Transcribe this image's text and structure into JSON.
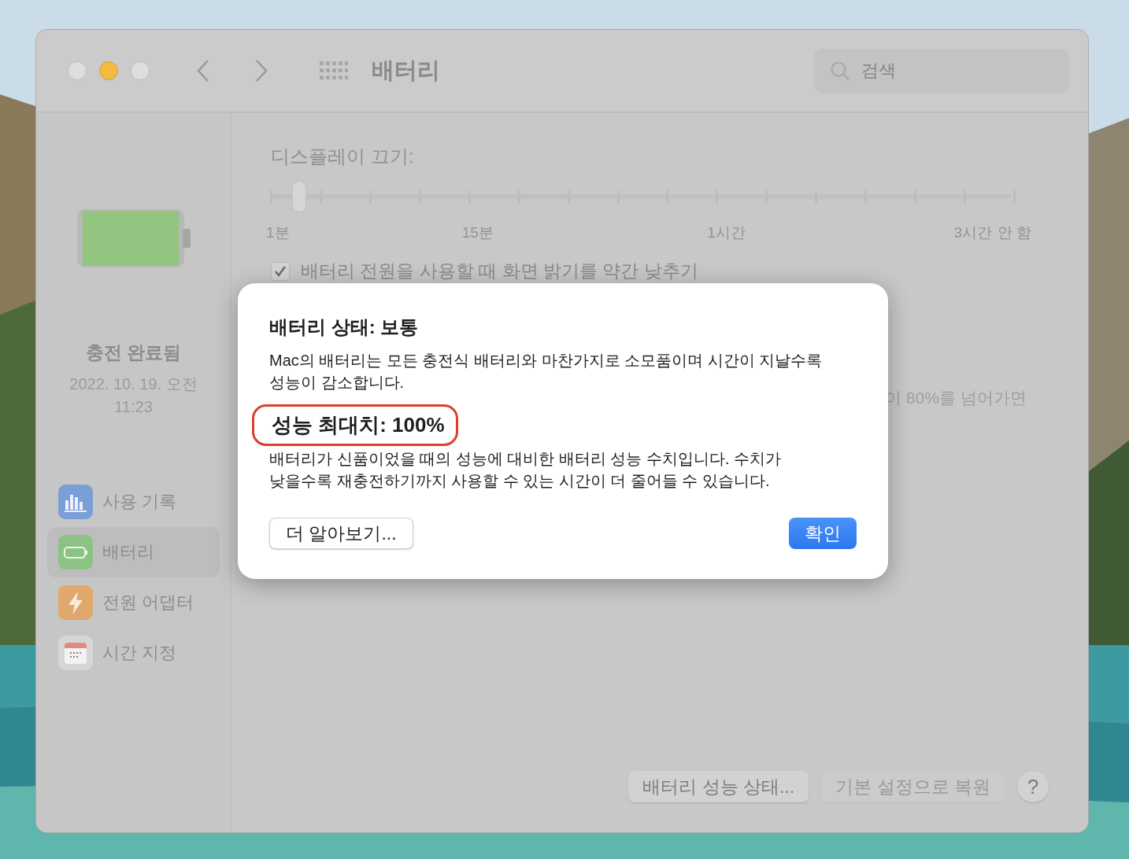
{
  "window": {
    "title": "배터리",
    "search": {
      "placeholder": "검색"
    }
  },
  "sidebar": {
    "status": "충전 완료됨",
    "date": "2022. 10. 19. 오전 11:23",
    "items": [
      {
        "label": "사용 기록",
        "kind": "usage",
        "selected": false
      },
      {
        "label": "배터리",
        "kind": "battery",
        "selected": true
      },
      {
        "label": "전원 어댑터",
        "kind": "adapter",
        "selected": false
      },
      {
        "label": "시간 지정",
        "kind": "schedule",
        "selected": false
      }
    ]
  },
  "display_off": {
    "label": "디스플레이 끄기:",
    "level": 0.04,
    "labels": [
      "1분",
      "15분",
      "1시간",
      "3시간",
      "안 함"
    ]
  },
  "dim_checkbox": {
    "label": "배터리 전원을 사용할 때 화면 밝기를 약간 낮추기",
    "checked": true
  },
  "partial_text": "이 80%를 넘어가면",
  "buttons": [
    {
      "label": "배터리 성능 상태...",
      "disabled": false
    },
    {
      "label": "기본 설정으로 복원",
      "disabled": true
    }
  ],
  "help": "?",
  "dialog": {
    "title": "배터리 상태: 보통",
    "text": "Mac의 배터리는 모든 충전식 배터리와 마찬가지로 소모품이며 시간이 지날수록 성능이 감소합니다.",
    "capacity": "성능 최대치: 100%",
    "capacity_text": "배터리가 신품이었을 때의 성능에 대비한 배터리 성능 수치입니다. 수치가 낮을수록 재충전하기까지 사용할 수 있는 시간이 더 줄어들 수 있습니다.",
    "learn_more": "더 알아보기...",
    "ok": "확인"
  }
}
